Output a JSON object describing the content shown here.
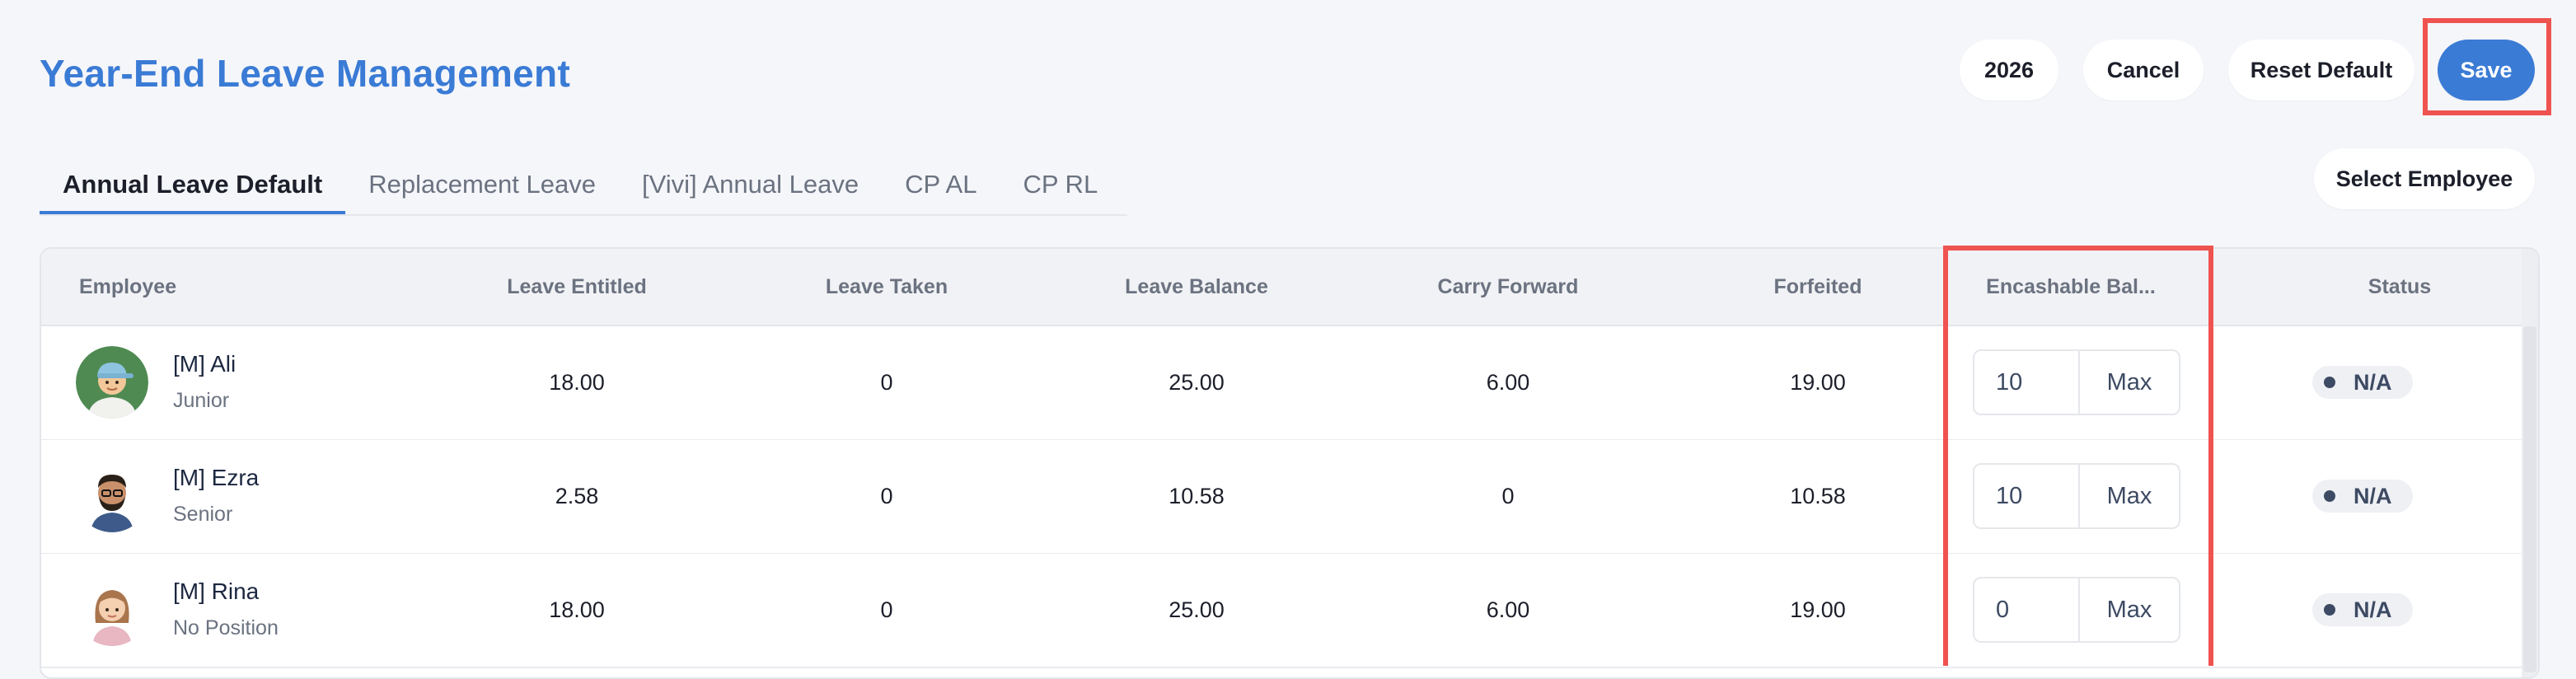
{
  "page": {
    "title": "Year-End Leave Management"
  },
  "header_actions": {
    "year": "2026",
    "cancel": "Cancel",
    "reset_default": "Reset Default",
    "save": "Save"
  },
  "tabs": [
    {
      "label": "Annual Leave Default",
      "active": true
    },
    {
      "label": "Replacement Leave",
      "active": false
    },
    {
      "label": "[Vivi] Annual Leave",
      "active": false
    },
    {
      "label": "CP AL",
      "active": false
    },
    {
      "label": "CP RL",
      "active": false
    }
  ],
  "select_employee": "Select Employee",
  "table": {
    "columns": [
      "Employee",
      "Leave Entitled",
      "Leave Taken",
      "Leave Balance",
      "Carry Forward",
      "Forfeited",
      "Encashable Bal...",
      "Status"
    ],
    "max_label": "Max",
    "rows": [
      {
        "name": "[M] Ali",
        "position": "Junior",
        "entitled": "18.00",
        "taken": "0",
        "balance": "25.00",
        "carry": "6.00",
        "forfeited": "19.00",
        "encashable": "10",
        "status": "N/A",
        "avatar": "avatar-boy-cap"
      },
      {
        "name": "[M] Ezra",
        "position": "Senior",
        "entitled": "2.58",
        "taken": "0",
        "balance": "10.58",
        "carry": "0",
        "forfeited": "10.58",
        "encashable": "10",
        "status": "N/A",
        "avatar": "avatar-man-beard"
      },
      {
        "name": "[M] Rina",
        "position": "No Position",
        "entitled": "18.00",
        "taken": "0",
        "balance": "25.00",
        "carry": "6.00",
        "forfeited": "19.00",
        "encashable": "0",
        "status": "N/A",
        "avatar": "avatar-woman"
      }
    ]
  },
  "colors": {
    "accent": "#3a7bd5",
    "highlight": "#ef5350",
    "background": "#f5f6fa"
  }
}
